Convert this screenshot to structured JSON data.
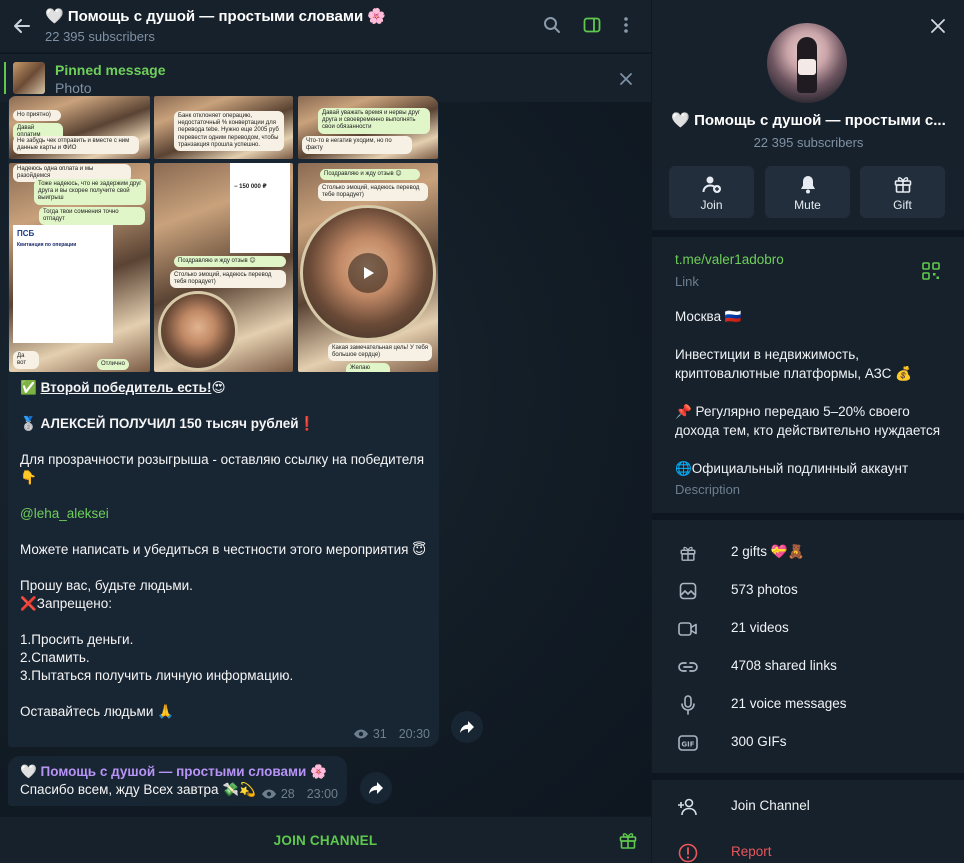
{
  "header": {
    "title": "🤍 Помощь с душой — простыми словами 🌸",
    "subscribers": "22 395 subscribers"
  },
  "pinned": {
    "title": "Pinned message",
    "subtitle": "Photo"
  },
  "album_snippets": {
    "p1": [
      "Но приятно)",
      "Давай оплатим",
      "Не забудь чек отправить и вместе с ним данные карты и ФИО"
    ],
    "p2": [
      "Банк отклоняет операцию, недостаточный % конвертации для перевода tebe. Нужно еще 2005 руб перевести одним переводом, чтобы транзакция прошла успешно."
    ],
    "p3": [
      "Давай уважать время и нервы друг друга и своевременно выполнять свои обязанности",
      "Что-то в негатив уходим, но по факту"
    ],
    "p4": [
      "Надеюсь одна оплата и мы разойдемся",
      "Тоже надеюсь, что не задержим друг друга и вы скорее получите свой выигрыш",
      "Тогда твои сомнения точно отпадут",
      "ПСБ",
      "Квитанция по операции",
      "Да вот",
      "Отлично"
    ],
    "p5": [
      "− 150 000 ₽",
      "Поздравляю и жду отзыв 😊",
      "Столько эмоций, надеюсь перевод тебя порадует)"
    ],
    "p6": [
      "Поздравляю и жду отзыв 😊",
      "Столько эмоций, надеюсь перевод тебе порадует)",
      "Какая замечательная цель! У тебя большое сердце)",
      "Желаю удачи!"
    ]
  },
  "message1": {
    "line1_prefix": "✅ ",
    "line1_bold": "Второй победитель есть!",
    "line1_suffix": "😍",
    "line2": "🥈 АЛЕКСЕЙ ПОЛУЧИЛ 150 тысяч рублей❗️",
    "line3": "Для прозрачности розыгрыша - оставляю ссылку на победителя 👇",
    "mention": "@leha_aleksei",
    "line4": "Можете написать и убедиться в честности этого мероприятия 😇",
    "line5": "Прошу вас, будьте людьми.\n❌Запрещено:",
    "line6": "1.Просить деньги.\n2.Спамить.\n3.Пытаться получить личную информацию.",
    "line7": "Оставайтесь людьми 🙏",
    "views": "31",
    "time": "20:30"
  },
  "message2": {
    "author": "🤍 Помощь с душой — простыми словами 🌸",
    "text": "Спасибо всем, жду Всех завтра 💸💫",
    "views": "28",
    "time": "23:00"
  },
  "bottom": {
    "join_label": "JOIN CHANNEL"
  },
  "profile": {
    "name": "🤍 Помощь с душой — простыми с...",
    "subscribers": "22 395 subscribers",
    "actions": {
      "join": "Join",
      "mute": "Mute",
      "gift": "Gift"
    },
    "link": "t.me/valer1adobro",
    "link_label": "Link",
    "description": [
      "Москва 🇷🇺",
      "Инвестиции в недвижимость, криптовалютные платформы, АЗС 💰",
      "📌 Регулярно передаю 5–20% своего дохода тем, кто действительно нуждается",
      "🌐Официальный подлинный аккаунт"
    ],
    "description_label": "Description",
    "media": {
      "gifts": "2 gifts 💝🧸",
      "photos": "573 photos",
      "videos": "21 videos",
      "links": "4708 shared links",
      "voice": "21 voice messages",
      "gifs": "300 GIFs"
    },
    "join_channel": "Join Channel",
    "report": "Report"
  },
  "colors": {
    "accent_green": "#5ec94d",
    "report_red": "#e8575c",
    "author_purple": "#b794f6",
    "panel_bg": "#17212b",
    "bubble_bg": "#182533"
  }
}
